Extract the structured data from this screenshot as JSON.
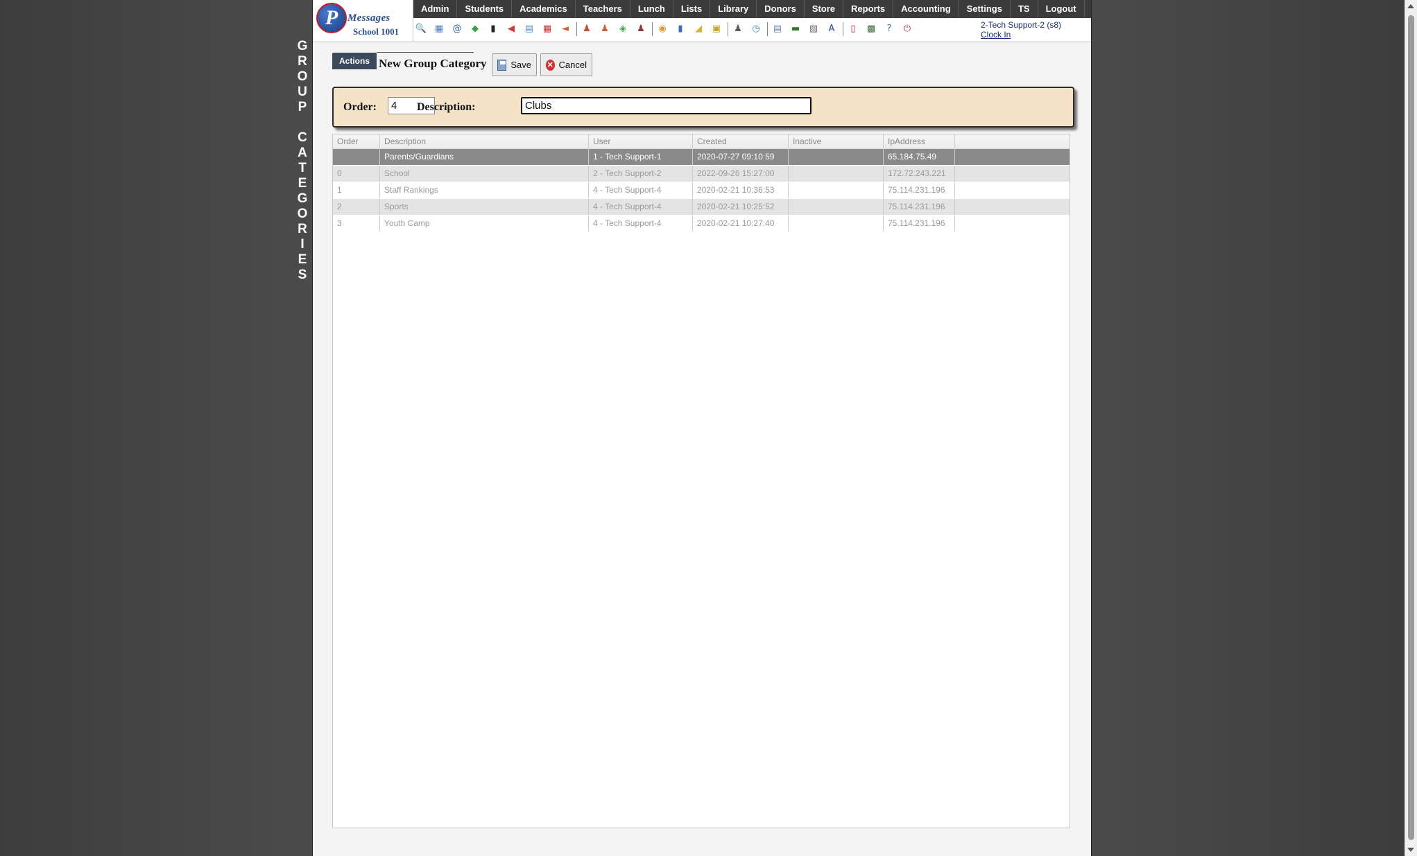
{
  "side_title": [
    "G",
    "R",
    "O",
    "U",
    "P",
    "",
    "C",
    "A",
    "T",
    "E",
    "G",
    "O",
    "R",
    "I",
    "E",
    "S"
  ],
  "logo": {
    "brand": "Messages",
    "initial": "P",
    "school": "School 1001"
  },
  "menu": [
    "Admin",
    "Students",
    "Academics",
    "Teachers",
    "Lunch",
    "Lists",
    "Library",
    "Donors",
    "Store",
    "Reports",
    "Accounting",
    "Settings",
    "TS",
    "Logout"
  ],
  "toolbar_icons": [
    {
      "name": "search-icon",
      "glyph": "🔍",
      "color": "#5b7fb5"
    },
    {
      "name": "grid-icon",
      "glyph": "▦",
      "color": "#4a7cc4"
    },
    {
      "name": "email-at-icon",
      "glyph": "@",
      "color": "#2a5cb5"
    },
    {
      "name": "chat-icon",
      "glyph": "◆",
      "color": "#3aa04a"
    },
    {
      "name": "mobile-phone-icon",
      "glyph": "▮",
      "color": "#222"
    },
    {
      "name": "speaker-icon",
      "glyph": "◀",
      "color": "#d23a3a"
    },
    {
      "name": "form-icon",
      "glyph": "▤",
      "color": "#5a8cc8"
    },
    {
      "name": "calendar-icon",
      "glyph": "▦",
      "color": "#c83232"
    },
    {
      "name": "megaphone-icon",
      "glyph": "◄",
      "color": "#c86432"
    },
    {
      "name": "separator",
      "glyph": "",
      "color": ""
    },
    {
      "name": "student-add-icon",
      "glyph": "♟",
      "color": "#c84a32"
    },
    {
      "name": "student-icon",
      "glyph": "♟",
      "color": "#c8643a"
    },
    {
      "name": "money-icon",
      "glyph": "◈",
      "color": "#4aa04a"
    },
    {
      "name": "group-icon",
      "glyph": "♟",
      "color": "#8a3a3a"
    },
    {
      "name": "separator",
      "glyph": "",
      "color": ""
    },
    {
      "name": "lunch-icon",
      "glyph": "◉",
      "color": "#d89a32"
    },
    {
      "name": "book-icon",
      "glyph": "▮",
      "color": "#3a6cc8"
    },
    {
      "name": "donation-icon",
      "glyph": "◢",
      "color": "#e0b030"
    },
    {
      "name": "store-icon",
      "glyph": "▣",
      "color": "#c8a032"
    },
    {
      "name": "separator",
      "glyph": "",
      "color": ""
    },
    {
      "name": "user-icon",
      "glyph": "♟",
      "color": "#5a5a5a"
    },
    {
      "name": "clock-icon",
      "glyph": "◷",
      "color": "#3a8cc8"
    },
    {
      "name": "separator",
      "glyph": "",
      "color": ""
    },
    {
      "name": "spreadsheet-icon",
      "glyph": "▤",
      "color": "#6a8cb8"
    },
    {
      "name": "barcode-icon",
      "glyph": "▬",
      "color": "#2a7a2a"
    },
    {
      "name": "printer-icon",
      "glyph": "▧",
      "color": "#6a6a6a"
    },
    {
      "name": "ab-icon",
      "glyph": "A",
      "color": "#2a4aa0"
    },
    {
      "name": "separator",
      "glyph": "",
      "color": ""
    },
    {
      "name": "pdf-icon",
      "glyph": "▯",
      "color": "#c82a2a"
    },
    {
      "name": "cash-icon",
      "glyph": "▩",
      "color": "#3a6a3a"
    },
    {
      "name": "help-icon",
      "glyph": "?",
      "color": "#3a6cc8"
    },
    {
      "name": "power-icon",
      "glyph": "⏻",
      "color": "#c82a2a"
    }
  ],
  "user": {
    "name": "2-Tech Support-2 (s8)",
    "clock_link": "Clock In"
  },
  "actions_tab": "Actions",
  "form": {
    "title": "New Group Category",
    "save_label": "Save",
    "cancel_label": "Cancel",
    "order_label": "Order:",
    "order_value": "4",
    "description_label": "Description:",
    "description_value": "Clubs"
  },
  "grid": {
    "columns": [
      "Order",
      "Description",
      "User",
      "Created",
      "Inactive",
      "IpAddress"
    ],
    "rows": [
      {
        "order": "",
        "description": "Parents/Guardians",
        "user": "1 - Tech Support-1",
        "created": "2020-07-27 09:10:59",
        "inactive": "",
        "ip": "65.184.75.49",
        "style": "sel"
      },
      {
        "order": "0",
        "description": "School",
        "user": "2 - Tech Support-2",
        "created": "2022-09-26 15:27:00",
        "inactive": "",
        "ip": "172.72.243.221",
        "style": "alt"
      },
      {
        "order": "1",
        "description": "Staff Rankings",
        "user": "4 - Tech Support-4",
        "created": "2020-02-21 10:36:53",
        "inactive": "",
        "ip": "75.114.231.196",
        "style": ""
      },
      {
        "order": "2",
        "description": "Sports",
        "user": "4 - Tech Support-4",
        "created": "2020-02-21 10:25:52",
        "inactive": "",
        "ip": "75.114.231.196",
        "style": "alt"
      },
      {
        "order": "3",
        "description": "Youth Camp",
        "user": "4 - Tech Support-4",
        "created": "2020-02-21 10:27:40",
        "inactive": "",
        "ip": "75.114.231.196",
        "style": ""
      }
    ]
  }
}
